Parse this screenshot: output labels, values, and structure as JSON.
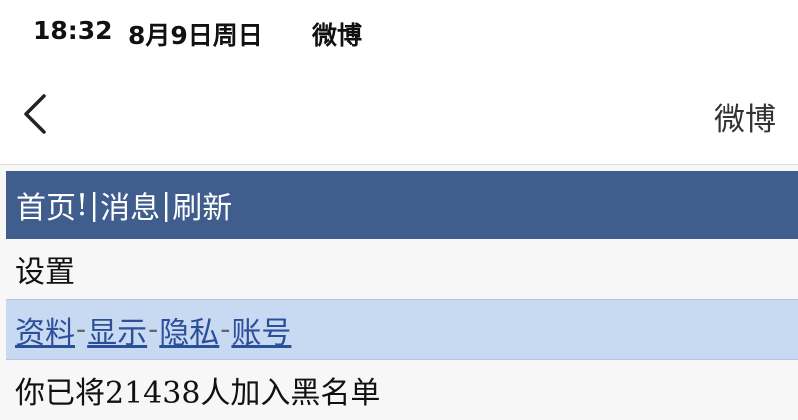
{
  "status_bar": {
    "time": "18:32",
    "date": "8月9日周日",
    "app": "微博"
  },
  "nav": {
    "back_icon": "chevron-left-icon",
    "title": "微博"
  },
  "top_menu": {
    "home": "首页",
    "bang": "!",
    "sep": "|",
    "messages": "消息",
    "refresh": "刷新"
  },
  "settings": {
    "heading": "设置",
    "links": {
      "profile": "资料",
      "display": "显示",
      "privacy": "隐私",
      "account": "账号"
    },
    "dash": "-",
    "blacklist_note": "你已将21438人加入黑名单"
  },
  "colors": {
    "menu_bar": "#3f5e8e",
    "settings_nav_bg": "#c8d9f2",
    "link": "#2c4f9a"
  }
}
